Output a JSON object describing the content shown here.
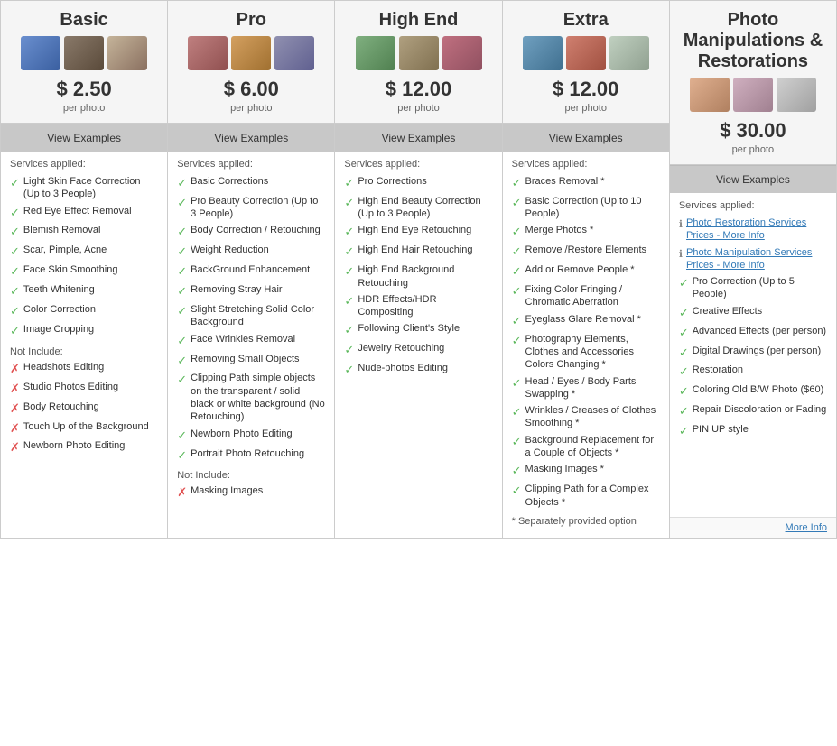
{
  "columns": [
    {
      "id": "basic",
      "title": "Basic",
      "price": "$ 2.50",
      "per_photo": "per photo",
      "view_examples": "View Examples",
      "photos": [
        "p1",
        "p2",
        "p3"
      ],
      "services_label": "Services applied:",
      "included": [
        "Light Skin Face Correction (Up to 3 People)",
        "Red Eye Effect Removal",
        "Blemish Removal",
        "Scar, Pimple, Acne",
        "Face Skin Smoothing",
        "Teeth Whitening",
        "Color Correction",
        "Image Cropping"
      ],
      "not_include_label": "Not Include:",
      "not_included": [
        "Headshots Editing",
        "Studio Photos Editing",
        "Body Retouching",
        "Touch Up of the Background",
        "Newborn Photo Editing"
      ]
    },
    {
      "id": "pro",
      "title": "Pro",
      "price": "$ 6.00",
      "per_photo": "per photo",
      "view_examples": "View Examples",
      "photos": [
        "p4",
        "p5",
        "p6"
      ],
      "services_label": "Services applied:",
      "included": [
        "Basic Corrections",
        "Pro Beauty Correction (Up to 3 People)",
        "Body Correction / Retouching",
        "Weight Reduction",
        "BackGround Enhancement",
        "Removing Stray Hair",
        "Slight Stretching Solid Color Background",
        "Face Wrinkles Removal",
        "Removing Small Objects",
        "Clipping Path simple objects on the transparent / solid black or white background (No Retouching)",
        "Newborn Photo Editing",
        "Portrait Photo Retouching"
      ],
      "not_include_label": "Not Include:",
      "not_included": [
        "Masking Images"
      ]
    },
    {
      "id": "high-end",
      "title": "High End",
      "price": "$ 12.00",
      "per_photo": "per photo",
      "view_examples": "View Examples",
      "photos": [
        "p7",
        "p8",
        "p9"
      ],
      "services_label": "Services applied:",
      "included": [
        "Pro Corrections",
        "High End Beauty Correction (Up to 3 People)",
        "High End Eye Retouching",
        "High End Hair Retouching",
        "High End Background Retouching",
        "HDR Effects/HDR Compositing",
        "Following Client's Style",
        "Jewelry Retouching",
        "Nude-photos Editing"
      ],
      "not_include_label": "",
      "not_included": []
    },
    {
      "id": "extra",
      "title": "Extra",
      "price": "$ 12.00",
      "per_photo": "per photo",
      "view_examples": "View Examples",
      "photos": [
        "p10",
        "p11",
        "p12"
      ],
      "services_label": "Services applied:",
      "included": [
        "Braces Removal *",
        "Basic Correction (Up to 10 People)",
        "Merge Photos *",
        "Remove /Restore Elements",
        "Add or Remove People *",
        "Fixing Color Fringing / Chromatic Aberration",
        "Eyeglass Glare Removal *",
        "Photography Elements, Clothes and Accessories Colors Changing *",
        "Head / Eyes / Body Parts Swapping *",
        "Wrinkles / Creases of Clothes Smoothing *",
        "Background Replacement for a Couple of Objects *",
        "Masking Images *",
        "Clipping Path for a Complex Objects *"
      ],
      "not_include_label": "* Separately provided option",
      "not_included": []
    },
    {
      "id": "manipulations",
      "title": "Photo Manipulations & Restorations",
      "price": "$ 30.00",
      "per_photo": "per photo",
      "view_examples": "View Examples",
      "photos": [
        "p13",
        "p14",
        "p15"
      ],
      "services_label": "Services applied:",
      "info_items": [
        {
          "text": "Photo Restoration Services",
          "link_text": "Prices - More Info"
        },
        {
          "text": "Photo Manipulation Services",
          "link_text": "Prices - More Info"
        }
      ],
      "included": [
        "Pro Correction (Up to 5 People)",
        "Creative Effects",
        "Advanced Effects (per person)",
        "Digital Drawings (per person)",
        "Restoration",
        "Coloring Old B/W Photo ($60)",
        "Repair Discoloration or Fading",
        "PIN UP style"
      ],
      "not_include_label": "",
      "not_included": []
    }
  ],
  "more_info": "More Info"
}
